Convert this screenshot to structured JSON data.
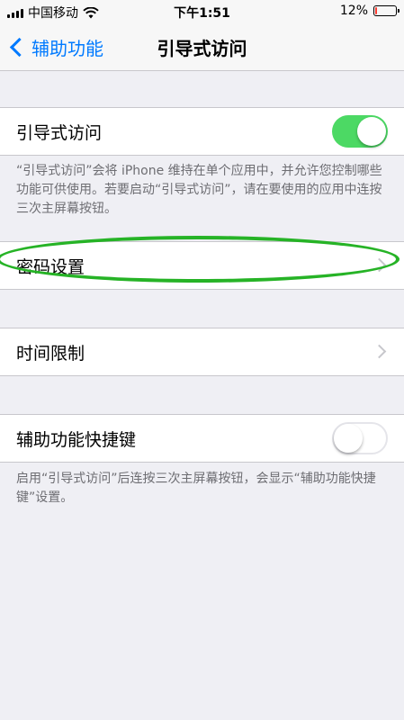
{
  "status_bar": {
    "carrier": "中国移动",
    "time": "下午1:51",
    "battery": "12%",
    "battery_level": 0.12,
    "icons": [
      "signal-icon",
      "wifi-icon",
      "battery-icon"
    ]
  },
  "nav": {
    "back_label": "辅助功能",
    "title": "引导式访问"
  },
  "guided_access": {
    "label": "引导式访问",
    "enabled": true,
    "footer": "“引导式访问”会将 iPhone 维持在单个应用中，并允许您控制哪些功能可供使用。若要启动“引导式访问”，请在要使用的应用中连按三次主屏幕按钮。"
  },
  "passcode_settings": {
    "label": "密码设置"
  },
  "time_limits": {
    "label": "时间限制"
  },
  "accessibility_shortcut": {
    "label": "辅助功能快捷键",
    "enabled": false,
    "footer": "启用“引导式访问”后连按三次主屏幕按钮，会显示“辅助功能快捷键”设置。"
  },
  "colors": {
    "accent": "#007aff",
    "toggle_on": "#4cd964",
    "annotation": "#26b326",
    "background": "#efeff4"
  }
}
